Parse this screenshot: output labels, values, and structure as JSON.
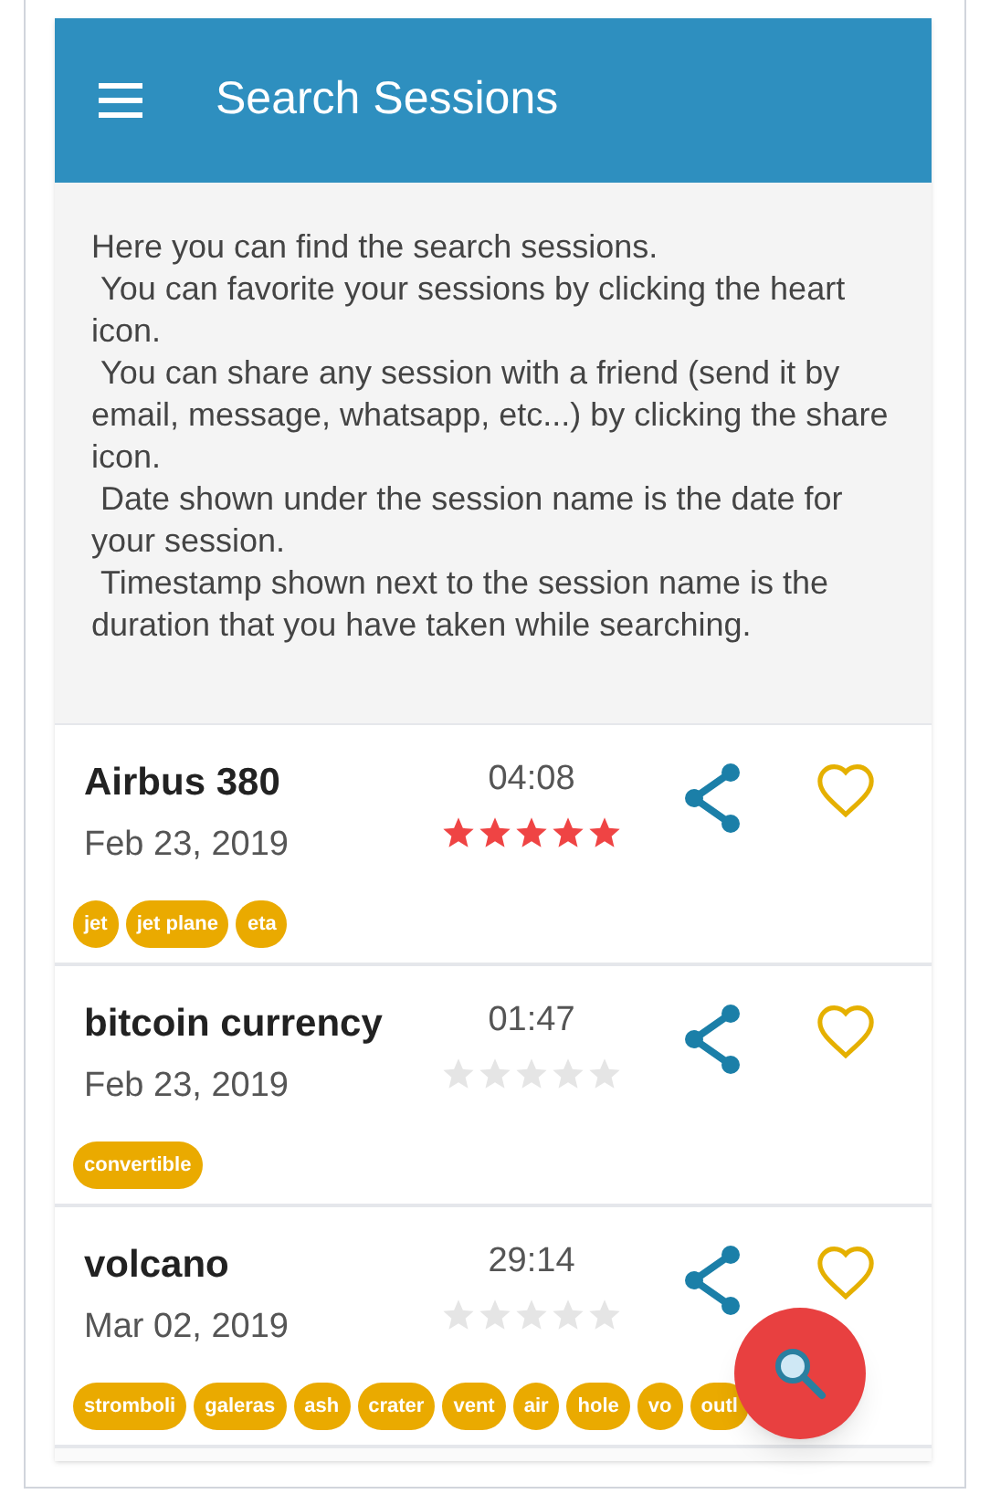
{
  "app_bar": {
    "title": "Search Sessions"
  },
  "intro": [
    "Here you can find the search sessions.",
    " You can favorite your sessions by clicking the heart icon.",
    " You can share any session with a friend (send it by email, message, whatsapp, etc...) by clicking the share icon.",
    " Date shown under the session name is the date for your session.",
    " Timestamp shown next to the session name is the duration that you have taken while searching."
  ],
  "sessions": [
    {
      "name": "Airbus 380",
      "date": "Feb 23, 2019",
      "duration": "04:08",
      "stars": 5,
      "favorite": false,
      "tags": [
        "jet",
        "jet plane",
        "eta"
      ]
    },
    {
      "name": "bitcoin currency",
      "date": "Feb 23, 2019",
      "duration": "01:47",
      "stars": 0,
      "favorite": false,
      "tags": [
        "convertible"
      ]
    },
    {
      "name": "volcano",
      "date": "Mar 02, 2019",
      "duration": "29:14",
      "stars": 0,
      "favorite": false,
      "tags": [
        "stromboli",
        "galeras",
        "ash",
        "crater",
        "vent",
        "air",
        "hole",
        "vo",
        "outl"
      ]
    }
  ]
}
